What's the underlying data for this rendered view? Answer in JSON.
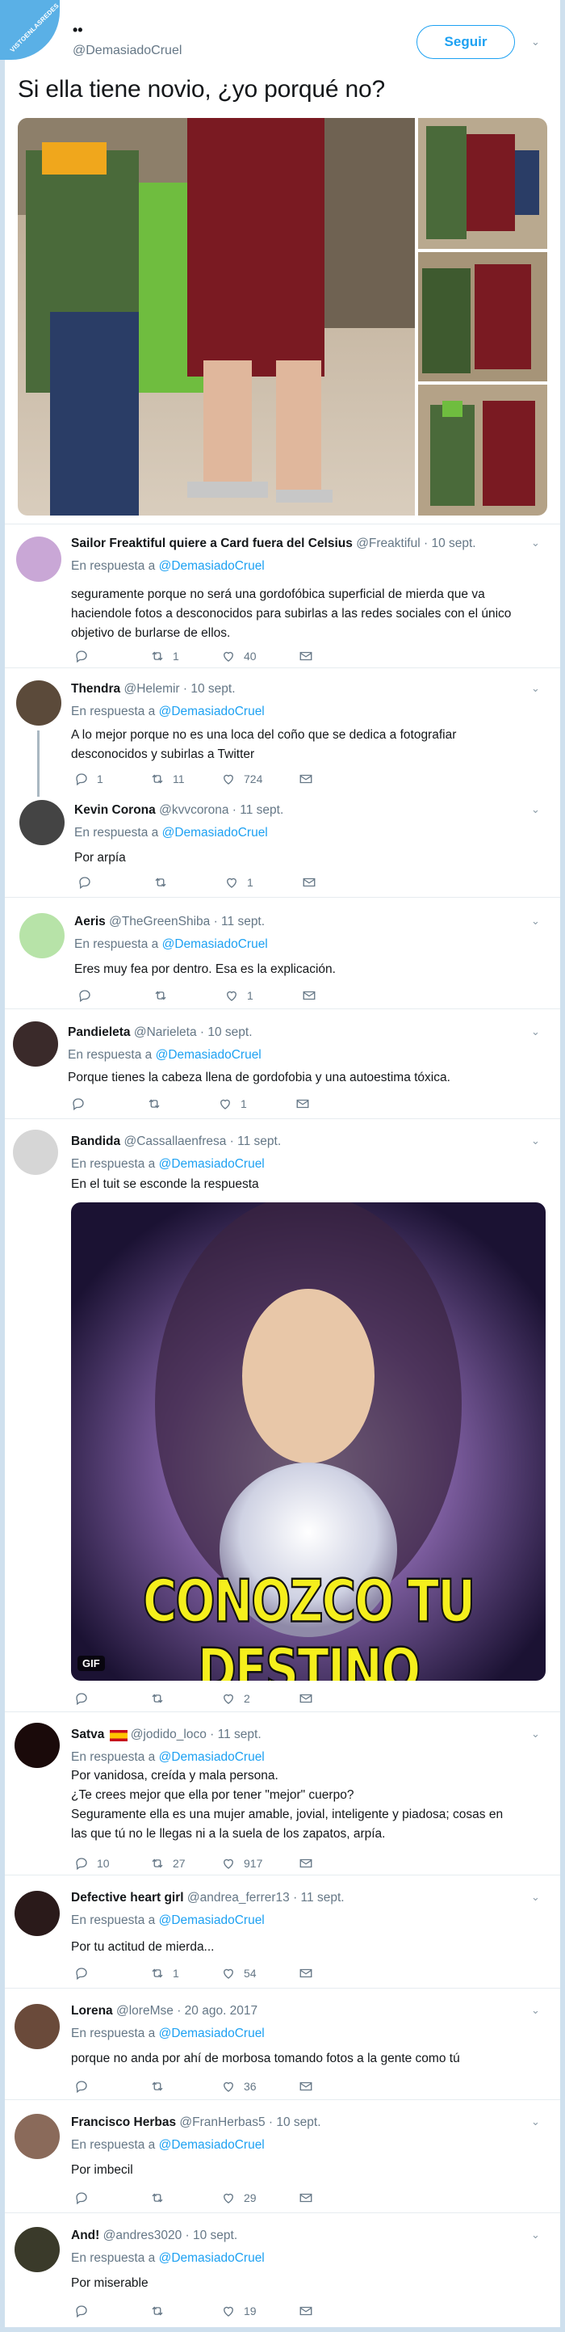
{
  "site_badge": "VISTOENLASREDES",
  "tweet": {
    "display_name": "••",
    "handle": "@DemasiadoCruel",
    "follow_label": "Seguir",
    "text": "Si ella tiene novio, ¿yo porqué no?"
  },
  "colors": {
    "accent": "#1da1f2",
    "muted": "#657786",
    "border": "#e6ecf0"
  },
  "replies": [
    {
      "name": "Sailor Freaktiful quiere a Card fuera del Celsius",
      "handle": "@Freaktiful",
      "date": "· 10 sept.",
      "in_reply_prefix": "En respuesta a ",
      "in_reply_to": "@DemasiadoCruel",
      "text": "seguramente porque no será una gordofóbica superficial de mierda que va\nhaciendole fotos a desconocidos para subirlas a las redes sociales con el único\nobjetivo de burlarse de ellos.",
      "replies": "",
      "retweets": "1",
      "likes": "40"
    },
    {
      "name": "Thendra",
      "handle": "@Helemir",
      "date": "· 10 sept.",
      "in_reply_prefix": "En respuesta a ",
      "in_reply_to": "@DemasiadoCruel",
      "text": "A lo mejor porque no es una loca del coño que se dedica a fotografiar\ndesconocidos y subirlas a Twitter",
      "replies": "1",
      "retweets": "11",
      "likes": "724"
    },
    {
      "name": "Kevin Corona",
      "handle": "@kvvcorona",
      "date": "· 11 sept.",
      "in_reply_prefix": "En respuesta a ",
      "in_reply_to": "@DemasiadoCruel",
      "text": "Por arpía",
      "replies": "",
      "retweets": "",
      "likes": "1"
    },
    {
      "name": "Aeris",
      "handle": "@TheGreenShiba",
      "date": "· 11 sept.",
      "in_reply_prefix": "En respuesta a ",
      "in_reply_to": "@DemasiadoCruel",
      "text": "Eres muy fea por dentro. Esa es la explicación.",
      "replies": "",
      "retweets": "",
      "likes": "1"
    },
    {
      "name": "Pandieleta",
      "handle": "@Narieleta",
      "date": "· 10 sept.",
      "in_reply_prefix": "En respuesta a ",
      "in_reply_to": "@DemasiadoCruel",
      "text": "Porque tienes la cabeza llena de gordofobia y una autoestima tóxica.",
      "replies": "",
      "retweets": "",
      "likes": "1"
    },
    {
      "name": "Bandida",
      "handle": "@Cassallaenfresa",
      "date": "· 11 sept.",
      "in_reply_prefix": "En respuesta a ",
      "in_reply_to": "@DemasiadoCruel",
      "text": "En el tuit se esconde la respuesta",
      "replies": "",
      "retweets": "",
      "likes": "2",
      "gif_caption": "CONOZCO TU DESTINO",
      "gif_label": "GIF"
    },
    {
      "name": "Satva",
      "handle": "@jodido_loco",
      "date": "· 11 sept.",
      "in_reply_prefix": "En respuesta a ",
      "in_reply_to": "@DemasiadoCruel",
      "text": "Por vanidosa, creída y mala persona.\n¿Te crees mejor que ella por tener \"mejor\" cuerpo?\nSeguramente ella es una mujer amable, jovial, inteligente y piadosa; cosas en\nlas que tú no le llegas ni a la suela de los zapatos, arpía.",
      "replies": "10",
      "retweets": "27",
      "likes": "917"
    },
    {
      "name": "Defective heart girl",
      "handle": "@andrea_ferrer13",
      "date": "· 11 sept.",
      "in_reply_prefix": "En respuesta a ",
      "in_reply_to": "@DemasiadoCruel",
      "text": "Por tu actitud de mierda...",
      "replies": "",
      "retweets": "1",
      "likes": "54"
    },
    {
      "name": "Lorena",
      "handle": "@loreMse",
      "date": "· 20 ago. 2017",
      "in_reply_prefix": "En respuesta a ",
      "in_reply_to": "@DemasiadoCruel",
      "text": "porque no anda por ahí de morbosa tomando fotos a la gente como tú",
      "replies": "",
      "retweets": "",
      "likes": "36"
    },
    {
      "name": "Francisco Herbas",
      "handle": "@FranHerbas5",
      "date": "· 10 sept.",
      "in_reply_prefix": "En respuesta a ",
      "in_reply_to": "@DemasiadoCruel",
      "text": "Por imbecil",
      "replies": "",
      "retweets": "",
      "likes": "29"
    },
    {
      "name": "And!",
      "handle": "@andres3020",
      "date": "· 10 sept.",
      "in_reply_prefix": "En respuesta a ",
      "in_reply_to": "@DemasiadoCruel",
      "text": "Por miserable",
      "replies": "",
      "retweets": "",
      "likes": "19"
    }
  ]
}
